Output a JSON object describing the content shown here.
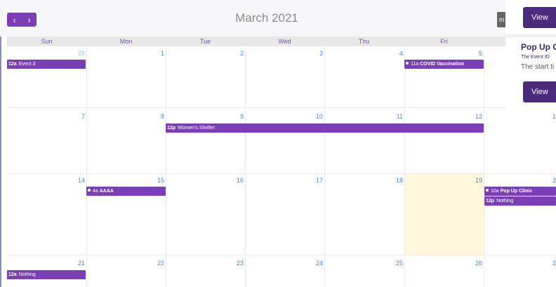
{
  "header": {
    "prev_icon": "chevron-left-icon",
    "next_icon": "chevron-right-icon",
    "prev_glyph": "‹",
    "next_glyph": "›",
    "title": "March 2021",
    "right_button_label": "m"
  },
  "colors": {
    "accent": "#7a3fb7",
    "day_number": "#4b86d6",
    "today_bg": "#fdf8dc",
    "panel_button": "#4a2a7a"
  },
  "weekdays": [
    "Sun",
    "Mon",
    "Tue",
    "Wed",
    "Thu",
    "Fri"
  ],
  "day_numbers": {
    "row1": [
      "28",
      "1",
      "2",
      "3",
      "4",
      "5"
    ],
    "row2": [
      "7",
      "8",
      "9",
      "10",
      "11",
      "12",
      "1"
    ],
    "row3": [
      "14",
      "15",
      "16",
      "17",
      "18",
      "19",
      "2"
    ],
    "row4": [
      "21",
      "22",
      "23",
      "24",
      "25",
      "26",
      "2"
    ]
  },
  "today": "19",
  "events": {
    "e1": {
      "time": "12a",
      "title": "Event 3"
    },
    "e2": {
      "time": "11a",
      "title": "COVID Vaccination"
    },
    "e3": {
      "time": "12p",
      "title": "Women's Shelter"
    },
    "e4": {
      "time": "4a",
      "title": "AAAA"
    },
    "e5": {
      "time": "10a",
      "title": "Pop Up Clinic"
    },
    "e6": {
      "time": "12p",
      "title": "Nothing"
    },
    "e7": {
      "time": "12a",
      "title": "Nothing"
    }
  },
  "panel": {
    "view_button_1": "View",
    "title": "Pop Up C",
    "line1": "The Event ID",
    "line2": "The start ti",
    "view_button_2": "View"
  }
}
